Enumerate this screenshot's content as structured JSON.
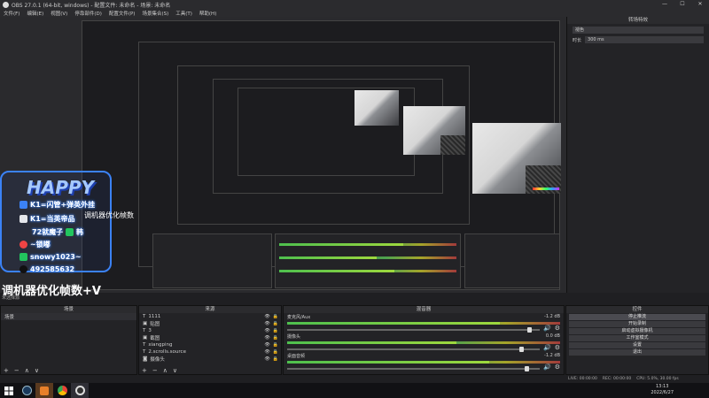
{
  "window": {
    "title": "OBS 27.0.1 (64-bit, windows) - 配置文件: 未命名 - 场景: 未命名",
    "minimize": "—",
    "maximize": "☐",
    "close": "✕"
  },
  "menu": [
    "文件(F)",
    "编辑(E)",
    "视图(V)",
    "停靠部件(D)",
    "配置文件(P)",
    "场景集合(S)",
    "工具(T)",
    "帮助(H)"
  ],
  "transition": {
    "title": "转场特效",
    "selected": "褪色",
    "duration_label": "时长",
    "duration_value": "300 ms"
  },
  "overlay": {
    "happy": "HAPPY",
    "line1": "K1=闪管+弹英外挂",
    "line2": "K1=当英帝品",
    "line3": "72就魔子",
    "line3_tag": "韩",
    "line4": "~锁嘟",
    "line5": "snowy1023~",
    "line6": "492585632",
    "side_text": "调机器优化帧数"
  },
  "caption": "调机器优化帧数+V",
  "status_line": "未选择源",
  "docks": {
    "scenes": {
      "title": "场景",
      "items": [
        "场景"
      ]
    },
    "sources": {
      "title": "来源",
      "items": [
        "1111",
        "贴图",
        "3",
        "截图",
        "xiangping",
        "2.scrolls.source",
        "摄像头"
      ]
    },
    "mixer": {
      "title": "混音器",
      "channels": [
        {
          "name": "麦克风/Aux",
          "db": "-1.2 dB",
          "level": 0.78,
          "volume": 0.95
        },
        {
          "name": "摄像头",
          "db": "0.0 dB",
          "level": 0.62,
          "volume": 0.92
        },
        {
          "name": "桌面音频",
          "db": "-1.2 dB",
          "level": 0.74,
          "volume": 0.94
        }
      ]
    },
    "controls": {
      "title": "控件",
      "buttons": [
        "停止推流",
        "开始录制",
        "启动虚拟摄像机",
        "工作室模式",
        "设置",
        "退出"
      ]
    }
  },
  "footer_buttons": [
    "+",
    "−",
    "∧",
    "∨"
  ],
  "obs_status": {
    "live": "LIVE: 00:00:00",
    "rec": "REC: 00:00:00",
    "cpu": "CPU: 5.0%, 30.00 fps"
  },
  "taskbar": {
    "time": "13:13",
    "date": "2022/6/27"
  },
  "colors": {
    "accent": "#3b82f6",
    "bg": "#1f1f22"
  }
}
